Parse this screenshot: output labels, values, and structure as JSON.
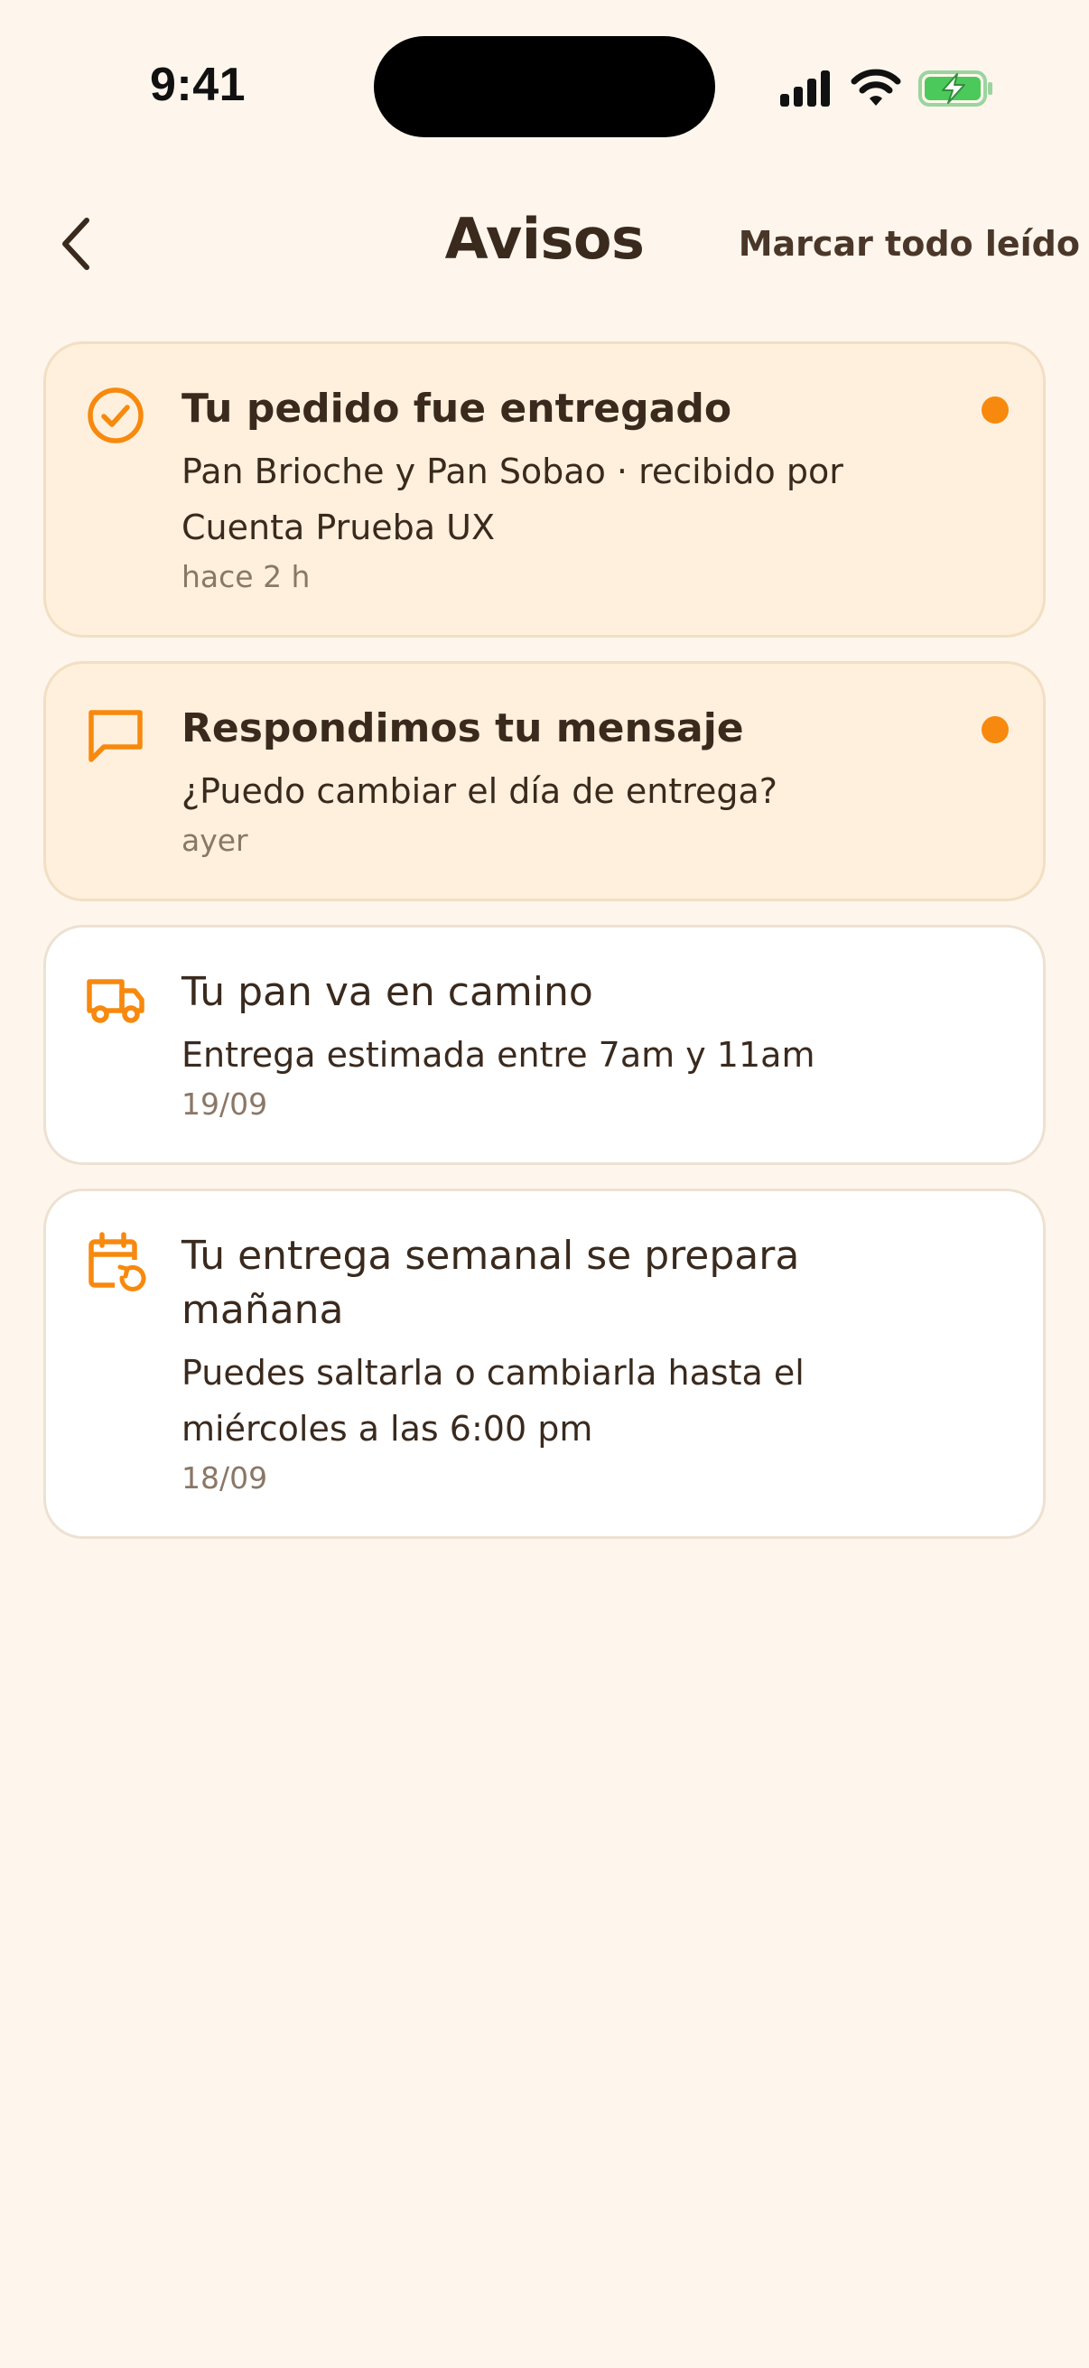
{
  "status_bar": {
    "time": "9:41"
  },
  "header": {
    "title": "Avisos",
    "mark_all_label": "Marcar todo leído"
  },
  "colors": {
    "accent": "#F7890E",
    "background": "#FEF6EC",
    "unread_card": "#FEF0DC",
    "text": "#3A2A1E"
  },
  "notifications": [
    {
      "icon": "check-circle-icon",
      "title": "Tu pedido fue entregado",
      "body": "Pan Brioche y Pan Sobao · recibido por Cuenta Prueba UX",
      "time": "hace 2 h",
      "unread": true
    },
    {
      "icon": "message-icon",
      "title": "Respondimos tu mensaje",
      "body": "¿Puedo cambiar el día de entrega?",
      "time": "ayer",
      "unread": true
    },
    {
      "icon": "truck-icon",
      "title": "Tu pan va en camino",
      "body": "Entrega estimada entre 7am y 11am",
      "time": "19/09",
      "unread": false
    },
    {
      "icon": "calendar-refresh-icon",
      "title": "Tu entrega semanal se prepara mañana",
      "body": "Puedes saltarla o cambiarla hasta el miércoles a las 6:00 pm",
      "time": "18/09",
      "unread": false
    }
  ]
}
